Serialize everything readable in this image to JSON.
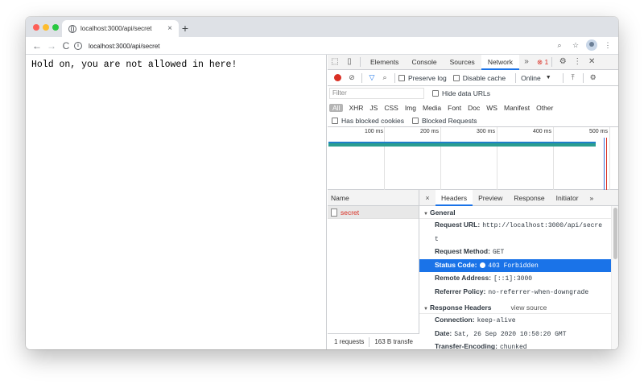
{
  "tab": {
    "title": "localhost:3000/api/secret",
    "close": "×",
    "new_tab": "+"
  },
  "toolbar": {
    "back": "←",
    "forward": "→",
    "reload": "C",
    "url": "localhost:3000/api/secret",
    "info": "i",
    "zoom_icon": "⌕",
    "star_icon": "☆",
    "menu_icon": "⋮"
  },
  "page": {
    "message": "Hold on, you are not allowed in here!"
  },
  "devtools": {
    "tabs": [
      "Elements",
      "Console",
      "Sources",
      "Network"
    ],
    "more": "»",
    "error_count": "1",
    "inspect_icon": "⬚",
    "device_icon": "▯",
    "settings_icon": "⚙",
    "menu_icon": "⋮",
    "close_icon": "✕",
    "network": {
      "preserve_log": "Preserve log",
      "disable_cache": "Disable cache",
      "throttle": "Online",
      "filter_placeholder": "Filter",
      "hide_data_urls": "Hide data URLs",
      "types": [
        "All",
        "XHR",
        "JS",
        "CSS",
        "Img",
        "Media",
        "Font",
        "Doc",
        "WS",
        "Manifest",
        "Other"
      ],
      "has_blocked_cookies": "Has blocked cookies",
      "blocked_requests": "Blocked Requests",
      "ticks": [
        "100 ms",
        "200 ms",
        "300 ms",
        "400 ms",
        "500 ms"
      ],
      "name_header": "Name",
      "request_name": "secret",
      "requests_count": "1 requests",
      "transferred": "163 B transfe"
    },
    "detail": {
      "close": "×",
      "tabs": [
        "Headers",
        "Preview",
        "Response",
        "Initiator"
      ],
      "more": "»",
      "general_title": "General",
      "request_url_label": "Request URL:",
      "request_url_1": "http://localhost:3000/api/secre",
      "request_url_2": "t",
      "request_method_label": "Request Method:",
      "request_method": "GET",
      "status_code_label": "Status Code:",
      "status_code": "403 Forbidden",
      "remote_address_label": "Remote Address:",
      "remote_address": "[::1]:3000",
      "referrer_policy_label": "Referrer Policy:",
      "referrer_policy": "no-referrer-when-downgrade",
      "response_headers_title": "Response Headers",
      "view_source": "view source",
      "connection_label": "Connection:",
      "connection": "keep-alive",
      "date_label": "Date:",
      "date": "Sat, 26 Sep 2020 10:50:20 GMT",
      "transfer_encoding_label": "Transfer-Encoding:",
      "transfer_encoding": "chunked"
    }
  }
}
